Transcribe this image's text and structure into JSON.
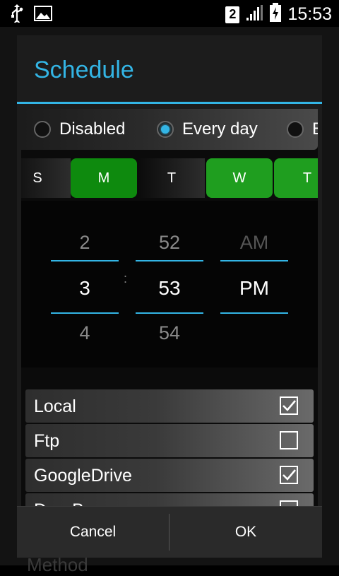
{
  "status_bar": {
    "sim": "2",
    "time": "15:53",
    "icons": [
      "usb-icon",
      "image-icon",
      "signal-icon",
      "battery-charging-icon"
    ]
  },
  "backdrop": {
    "partial_text": "Method"
  },
  "dialog": {
    "title": "Schedule",
    "frequency": {
      "options": [
        "Disabled",
        "Every day",
        "E"
      ],
      "selected": "Every day"
    },
    "days": [
      {
        "label": "S",
        "on": false
      },
      {
        "label": "M",
        "on": true
      },
      {
        "label": "T",
        "on": false
      },
      {
        "label": "W",
        "on": true
      },
      {
        "label": "T",
        "on": true
      }
    ],
    "time_picker": {
      "hour": {
        "prev": "2",
        "current": "3",
        "next": "4"
      },
      "separator": ":",
      "minute": {
        "prev": "52",
        "current": "53",
        "next": "54"
      },
      "ampm": {
        "prev": "AM",
        "current": "PM",
        "next": ""
      }
    },
    "targets": [
      {
        "label": "Local",
        "checked": true
      },
      {
        "label": "Ftp",
        "checked": false
      },
      {
        "label": "GoogleDrive",
        "checked": true
      },
      {
        "label": "DropBox",
        "checked": true
      }
    ],
    "buttons": {
      "cancel": "Cancel",
      "ok": "OK"
    },
    "colors": {
      "accent": "#33b5e5",
      "day_on": "#1f9e1f"
    }
  }
}
